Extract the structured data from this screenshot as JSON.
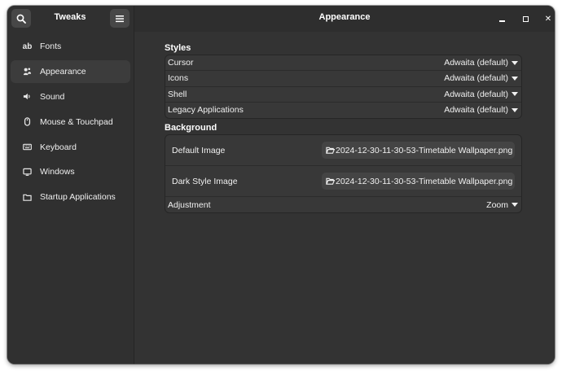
{
  "sidebar": {
    "title": "Tweaks",
    "search_icon": "search-icon",
    "menu_icon": "hamburger-menu-icon",
    "items": [
      {
        "label": "Fonts",
        "icon": "ab"
      },
      {
        "label": "Appearance",
        "icon": "appearance-icon"
      },
      {
        "label": "Sound",
        "icon": "speaker-icon"
      },
      {
        "label": "Mouse & Touchpad",
        "icon": "mouse-icon"
      },
      {
        "label": "Keyboard",
        "icon": "keyboard-icon"
      },
      {
        "label": "Windows",
        "icon": "monitor-icon"
      },
      {
        "label": "Startup Applications",
        "icon": "folder-icon"
      }
    ]
  },
  "header": {
    "title": "Appearance",
    "minimize": "_",
    "maximize": "□",
    "close": "✕"
  },
  "styles": {
    "heading": "Styles",
    "rows": [
      {
        "label": "Cursor",
        "value": "Adwaita (default)"
      },
      {
        "label": "Icons",
        "value": "Adwaita (default)"
      },
      {
        "label": "Shell",
        "value": "Adwaita (default)"
      },
      {
        "label": "Legacy Applications",
        "value": "Adwaita (default)"
      }
    ]
  },
  "background": {
    "heading": "Background",
    "default_image_label": "Default Image",
    "default_image_value": "2024-12-30-11-30-53-Timetable Wallpaper.png",
    "dark_image_label": "Dark Style Image",
    "dark_image_value": "2024-12-30-11-30-53-Timetable Wallpaper.png",
    "adjustment_label": "Adjustment",
    "adjustment_value": "Zoom"
  },
  "colors": {
    "window_bg": "#2e2e2e",
    "sidebar_bg": "#303030",
    "selected_bg": "#3c3c3c",
    "list_bg": "#383838",
    "text": "#ffffff"
  }
}
